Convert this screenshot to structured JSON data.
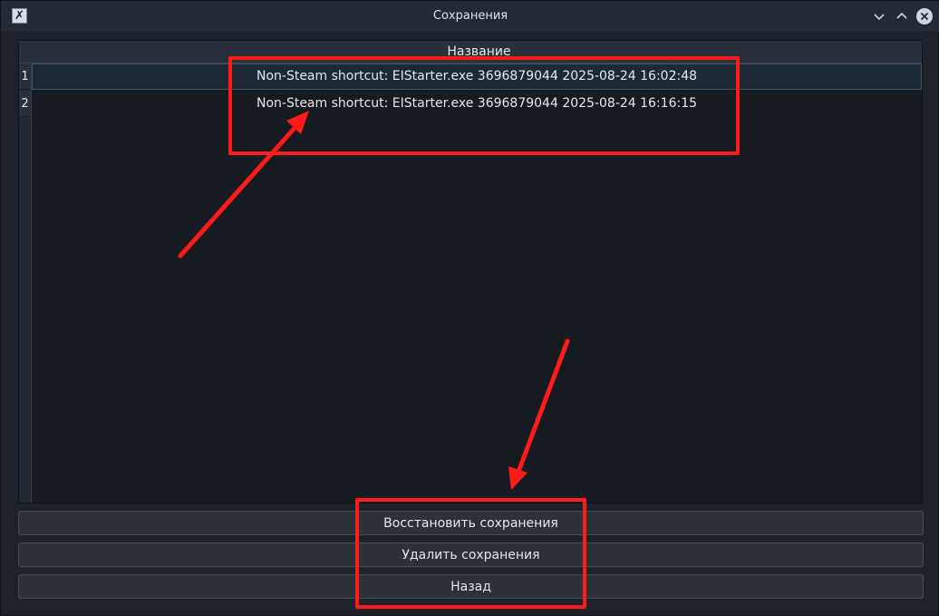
{
  "window": {
    "title": "Сохранения",
    "app_icon": "x-app-icon",
    "controls": [
      "minimize",
      "maximize",
      "close"
    ]
  },
  "table": {
    "column_header": "Название",
    "rows": [
      {
        "index": "1",
        "name": "Non-Steam shortcut: EIStarter.exe 3696879044 2025-08-24 16:02:48",
        "selected": true
      },
      {
        "index": "2",
        "name": "Non-Steam shortcut: EIStarter.exe 3696879044 2025-08-24 16:16:15",
        "selected": false
      }
    ]
  },
  "buttons": {
    "restore": "Восстановить сохранения",
    "delete": "Удалить сохранения",
    "back": "Назад"
  },
  "colors": {
    "annotation": "#ff1a1a",
    "selection_border": "#3e5566"
  }
}
